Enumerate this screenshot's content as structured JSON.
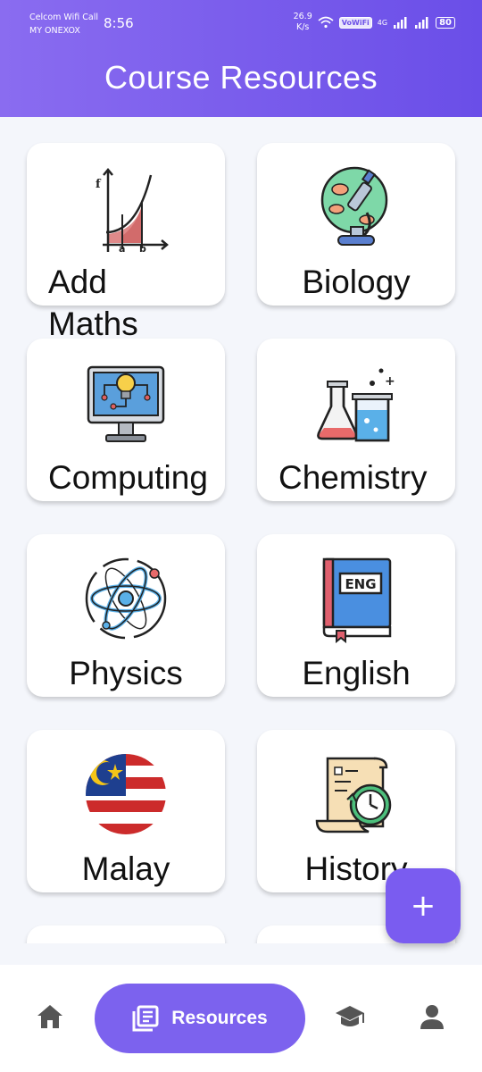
{
  "status_bar": {
    "carrier_line1": "Celcom Wifi Call",
    "carrier_line2": "MY ONEXOX",
    "time": "8:56",
    "speed_value": "26.9",
    "speed_unit": "K/s",
    "volte_badge": "VoWiFi",
    "network": "4G",
    "battery": "80"
  },
  "header": {
    "title": "Course Resources"
  },
  "courses": [
    {
      "label": "Add Maths",
      "icon": "integral-graph-icon"
    },
    {
      "label": "Biology",
      "icon": "microscope-icon"
    },
    {
      "label": "Computing",
      "icon": "computer-lightbulb-icon"
    },
    {
      "label": "Chemistry",
      "icon": "flask-beaker-icon"
    },
    {
      "label": "Physics",
      "icon": "atom-icon"
    },
    {
      "label": "English",
      "icon": "eng-book-icon"
    },
    {
      "label": "Malay",
      "icon": "malaysia-flag-icon"
    },
    {
      "label": "History",
      "icon": "scroll-clock-icon"
    }
  ],
  "fab": {
    "label": "+"
  },
  "bottom_nav": {
    "home_icon": "home-icon",
    "resources_label": "Resources",
    "resources_icon": "resources-icon",
    "courses_icon": "graduation-cap-icon",
    "profile_icon": "person-icon"
  },
  "colors": {
    "primary": "#7a5cf0",
    "header_start": "#8a6cf0",
    "header_end": "#6a4ee8",
    "background": "#f4f6fb"
  }
}
